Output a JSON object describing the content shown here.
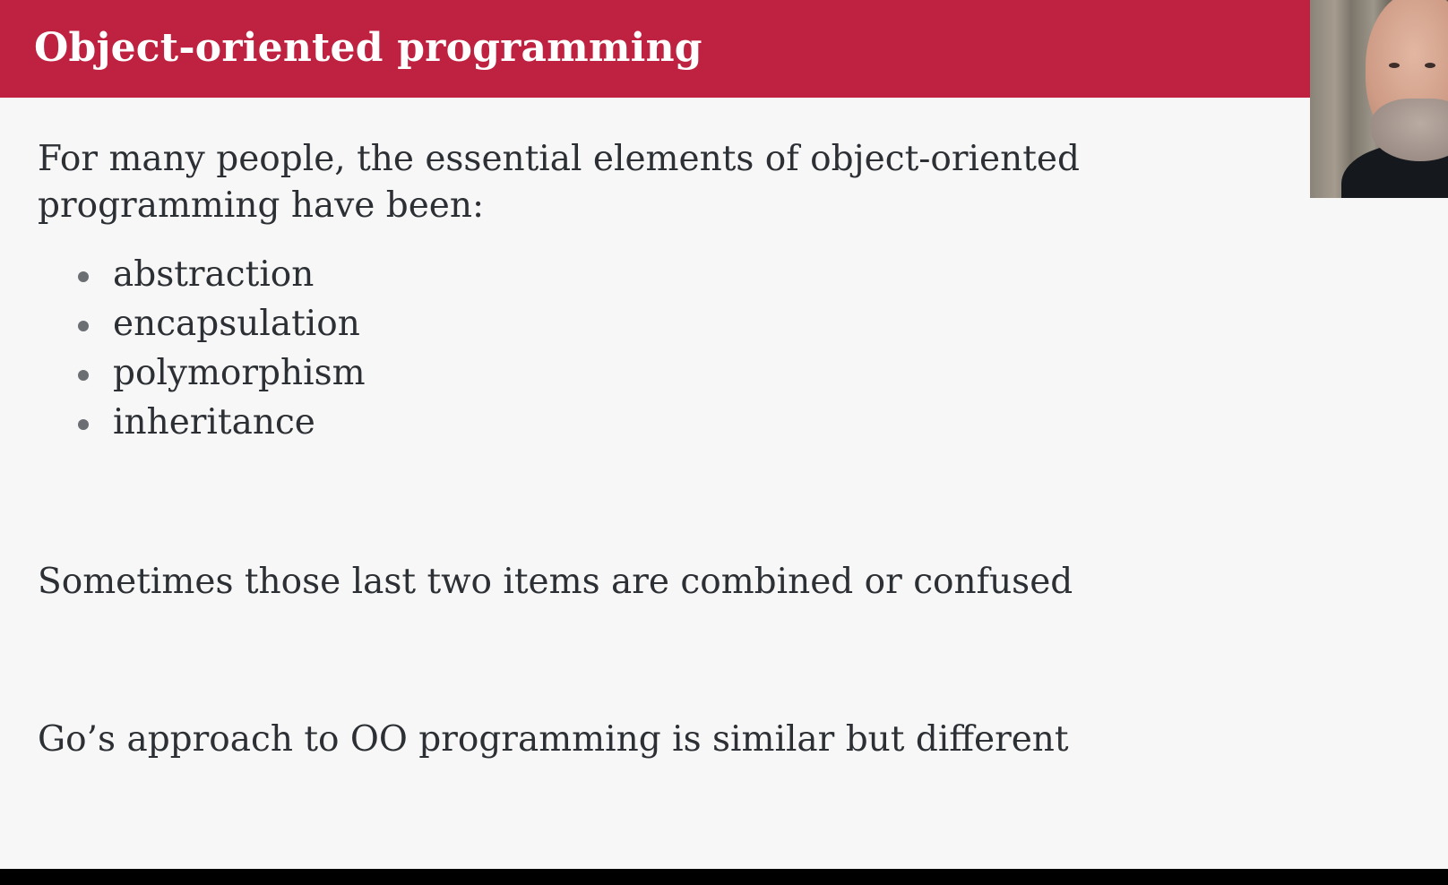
{
  "slide": {
    "title": "Object-oriented programming",
    "intro": "For many people, the essential elements of object-oriented programming have been:",
    "bullets": [
      "abstraction",
      "encapsulation",
      "polymorphism",
      "inheritance"
    ],
    "note_combined": "Sometimes those last two items are combined or confused",
    "note_go": "Go’s approach to OO programming is similar but different"
  },
  "colors": {
    "title_bar": "#be2240",
    "background": "#f7f7f7",
    "text": "#2c2f33"
  }
}
